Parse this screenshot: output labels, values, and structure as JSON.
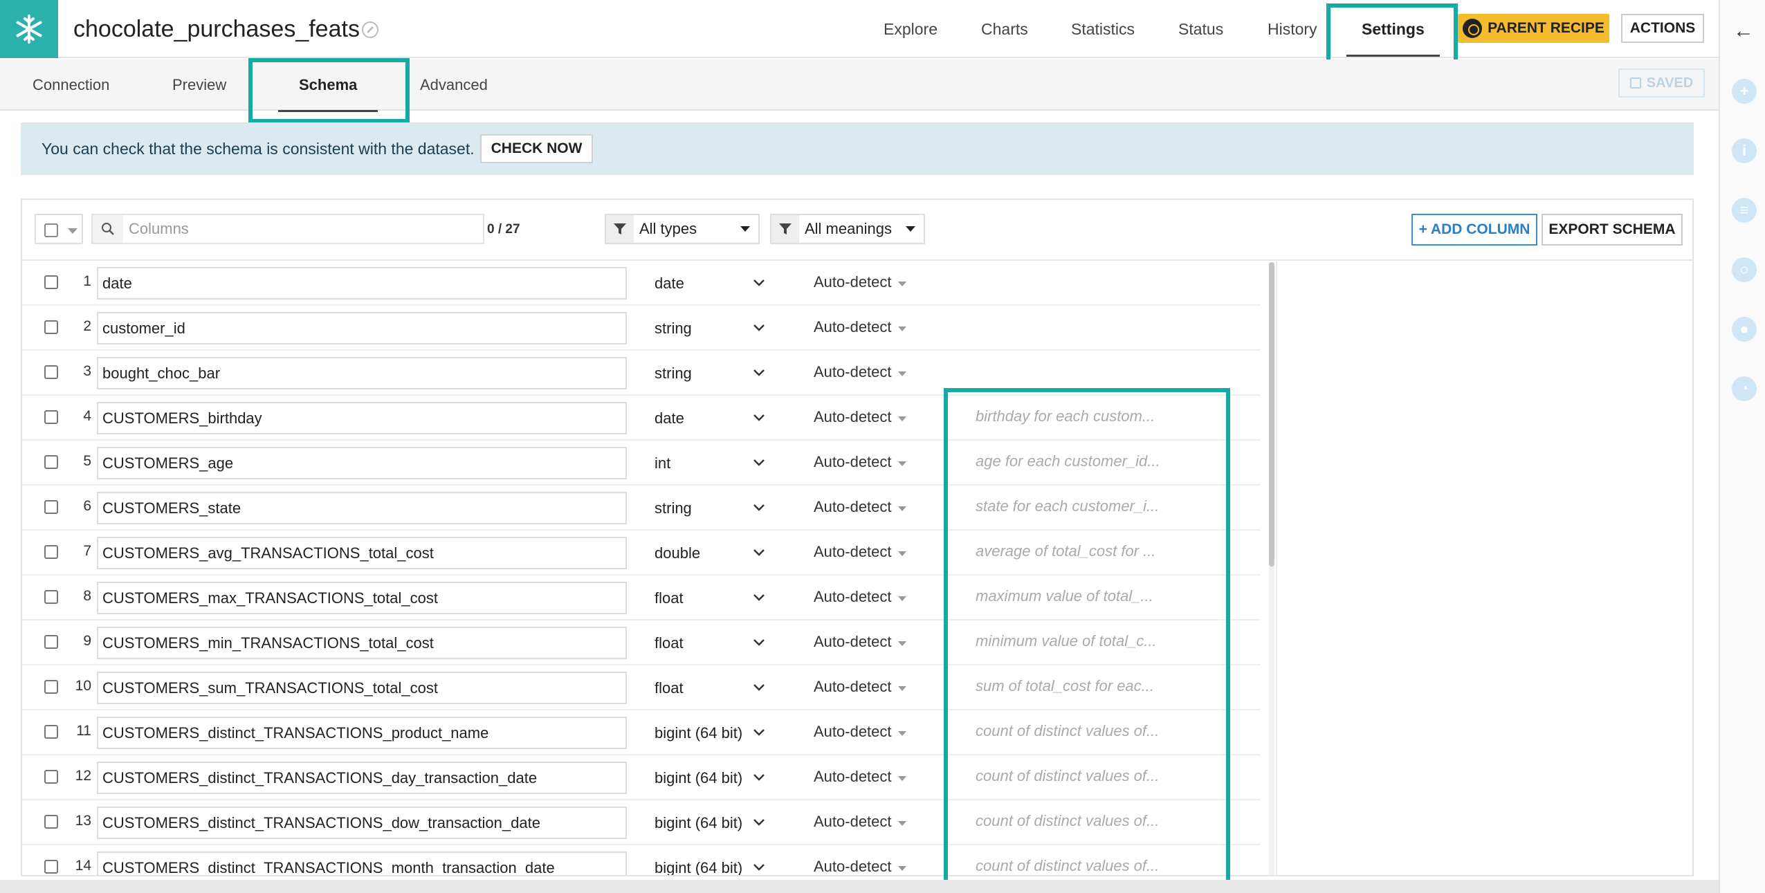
{
  "header": {
    "dataset_name": "chocolate_purchases_feats",
    "nav": [
      "Explore",
      "Charts",
      "Statistics",
      "Status",
      "History",
      "Settings"
    ],
    "active_nav": "Settings",
    "parent_recipe_label": "PARENT RECIPE",
    "actions_label": "ACTIONS"
  },
  "subtabs": {
    "items": [
      "Connection",
      "Preview",
      "Schema",
      "Advanced"
    ],
    "active": "Schema",
    "saved_label": "SAVED"
  },
  "banner": {
    "text": "You can check that the schema is consistent with the dataset.",
    "button": "CHECK NOW"
  },
  "toolbar": {
    "search_placeholder": "Columns",
    "count": "0 / 27",
    "type_filter": "All types",
    "meaning_filter": "All meanings",
    "add_column": "+ ADD COLUMN",
    "export_schema": "EXPORT SCHEMA"
  },
  "columns": [
    {
      "idx": "1",
      "name": "date",
      "type": "date",
      "meaning": "Auto-detect",
      "description": ""
    },
    {
      "idx": "2",
      "name": "customer_id",
      "type": "string",
      "meaning": "Auto-detect",
      "description": ""
    },
    {
      "idx": "3",
      "name": "bought_choc_bar",
      "type": "string",
      "meaning": "Auto-detect",
      "description": ""
    },
    {
      "idx": "4",
      "name": "CUSTOMERS_birthday",
      "type": "date",
      "meaning": "Auto-detect",
      "description": "birthday for each custom..."
    },
    {
      "idx": "5",
      "name": "CUSTOMERS_age",
      "type": "int",
      "meaning": "Auto-detect",
      "description": "age for each customer_id..."
    },
    {
      "idx": "6",
      "name": "CUSTOMERS_state",
      "type": "string",
      "meaning": "Auto-detect",
      "description": "state for each customer_i..."
    },
    {
      "idx": "7",
      "name": "CUSTOMERS_avg_TRANSACTIONS_total_cost",
      "type": "double",
      "meaning": "Auto-detect",
      "description": "average of total_cost for ..."
    },
    {
      "idx": "8",
      "name": "CUSTOMERS_max_TRANSACTIONS_total_cost",
      "type": "float",
      "meaning": "Auto-detect",
      "description": "maximum value of total_..."
    },
    {
      "idx": "9",
      "name": "CUSTOMERS_min_TRANSACTIONS_total_cost",
      "type": "float",
      "meaning": "Auto-detect",
      "description": "minimum value of total_c..."
    },
    {
      "idx": "10",
      "name": "CUSTOMERS_sum_TRANSACTIONS_total_cost",
      "type": "float",
      "meaning": "Auto-detect",
      "description": "sum of total_cost for eac..."
    },
    {
      "idx": "11",
      "name": "CUSTOMERS_distinct_TRANSACTIONS_product_name",
      "type": "bigint (64 bit)",
      "meaning": "Auto-detect",
      "description": "count of distinct values of..."
    },
    {
      "idx": "12",
      "name": "CUSTOMERS_distinct_TRANSACTIONS_day_transaction_date",
      "type": "bigint (64 bit)",
      "meaning": "Auto-detect",
      "description": "count of distinct values of..."
    },
    {
      "idx": "13",
      "name": "CUSTOMERS_distinct_TRANSACTIONS_dow_transaction_date",
      "type": "bigint (64 bit)",
      "meaning": "Auto-detect",
      "description": "count of distinct values of..."
    },
    {
      "idx": "14",
      "name": "CUSTOMERS_distinct_TRANSACTIONS_month_transaction_date",
      "type": "bigint (64 bit)",
      "meaning": "Auto-detect",
      "description": "count of distinct values of..."
    }
  ],
  "colors": {
    "brand": "#2ab1ac",
    "highlight": "#17a9a3",
    "parent_recipe": "#f4bb2c",
    "banner_bg": "#dbe9f1",
    "link_blue": "#2a7fc4"
  },
  "icons": {
    "logo": "snowflake-icon",
    "edit": "edit-tag-icon",
    "rail": [
      "back-arrow-icon",
      "plus-icon",
      "info-icon",
      "list-icon",
      "chat-icon",
      "lab-icon",
      "clock-icon"
    ]
  }
}
